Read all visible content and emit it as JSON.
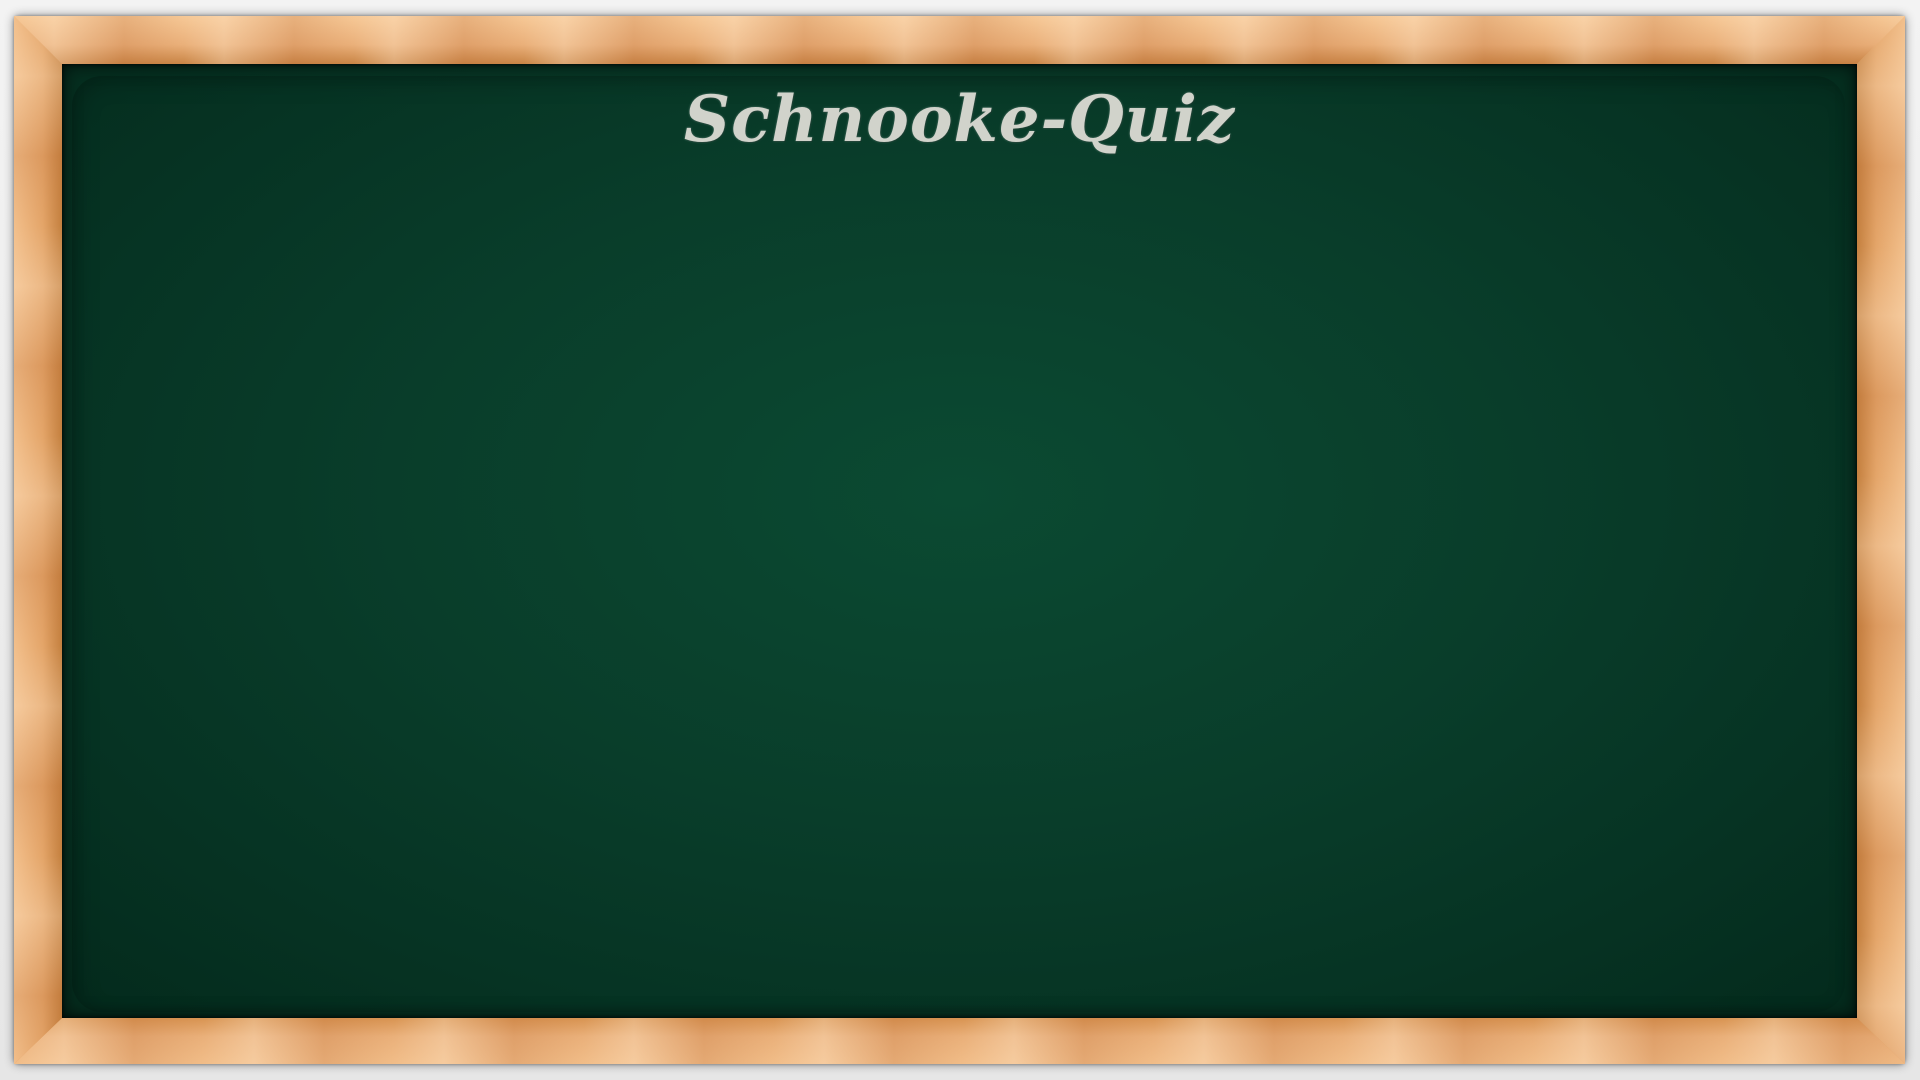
{
  "board": {
    "title": "Schnooke-Quiz"
  },
  "colors": {
    "board_green": "#093d2a",
    "chalk": "#dcdcd4",
    "wood": "#e7a86c"
  }
}
